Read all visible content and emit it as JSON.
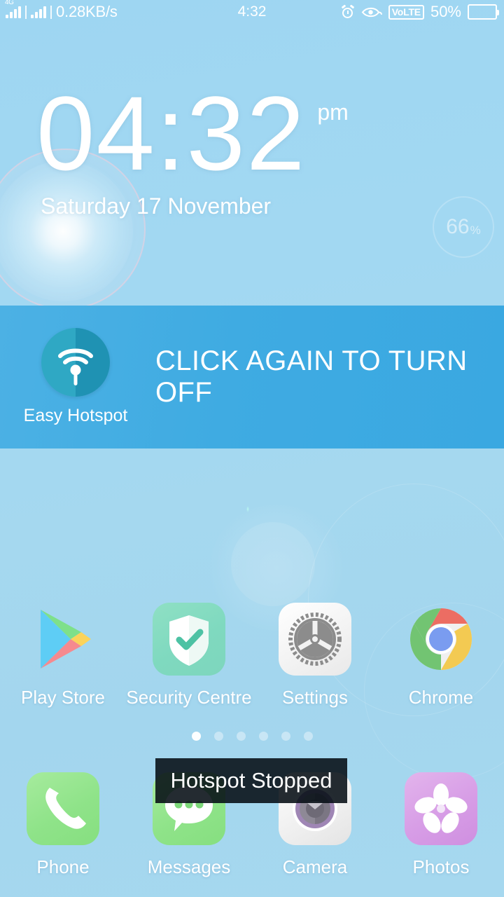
{
  "statusbar": {
    "network_type": "4G",
    "network_speed": "0.28KB/s",
    "time": "4:32",
    "volte_label": "VoLTE",
    "battery_percent": "50%",
    "icons": [
      "signal-4g-icon",
      "signal-sim2-icon",
      "alarm-icon",
      "eye-protection-icon",
      "volte-badge",
      "battery-icon"
    ]
  },
  "clock_widget": {
    "time": "04:32",
    "ampm": "pm",
    "date": "Saturday 17 November",
    "humidity_value": "66",
    "humidity_unit": "%"
  },
  "hotspot_banner": {
    "app_label": "Easy Hotspot",
    "message": "CLICK AGAIN TO TURN OFF",
    "background_color": "#3fabe2",
    "icon_color": "#2fa8c4"
  },
  "app_grid": [
    {
      "name": "Play Store",
      "icon": "play-store-icon"
    },
    {
      "name": "Security Centre",
      "icon": "security-shield-icon"
    },
    {
      "name": "Settings",
      "icon": "gear-icon"
    },
    {
      "name": "Chrome",
      "icon": "chrome-icon"
    }
  ],
  "dock": [
    {
      "name": "Phone",
      "icon": "phone-handset-icon"
    },
    {
      "name": "Messages",
      "icon": "message-bubble-icon"
    },
    {
      "name": "Camera",
      "icon": "camera-lens-icon"
    },
    {
      "name": "Photos",
      "icon": "flower-photos-icon"
    }
  ],
  "page_indicator": {
    "total": 6,
    "active_index": 0
  },
  "toast": {
    "message": "Hotspot Stopped"
  },
  "wallpaper": {
    "base_color": "#a2d8f2",
    "accent_color": "#ffffff"
  }
}
